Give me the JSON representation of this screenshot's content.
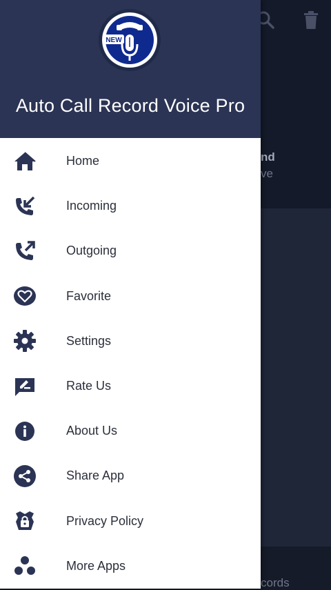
{
  "app": {
    "title": "Auto Call Record Voice Pro",
    "logo_badge": "NEW"
  },
  "menu": [
    {
      "label": "Home",
      "icon": "home-icon"
    },
    {
      "label": "Incoming",
      "icon": "incoming-call-icon"
    },
    {
      "label": "Outgoing",
      "icon": "outgoing-call-icon"
    },
    {
      "label": "Favorite",
      "icon": "heart-icon"
    },
    {
      "label": "Settings",
      "icon": "gear-icon"
    },
    {
      "label": "Rate Us",
      "icon": "rate-icon"
    },
    {
      "label": "About Us",
      "icon": "info-icon"
    },
    {
      "label": "Share App",
      "icon": "share-icon"
    },
    {
      "label": "Privacy Policy",
      "icon": "shield-lock-icon"
    },
    {
      "label": "More Apps",
      "icon": "more-apps-icon"
    }
  ],
  "background": {
    "partial_text_1": "nd",
    "partial_text_2": "ve",
    "partial_text_3": "cords"
  },
  "colors": {
    "header": "#2b3454",
    "icon": "#2b3454",
    "background_dim": "#1c2336"
  }
}
